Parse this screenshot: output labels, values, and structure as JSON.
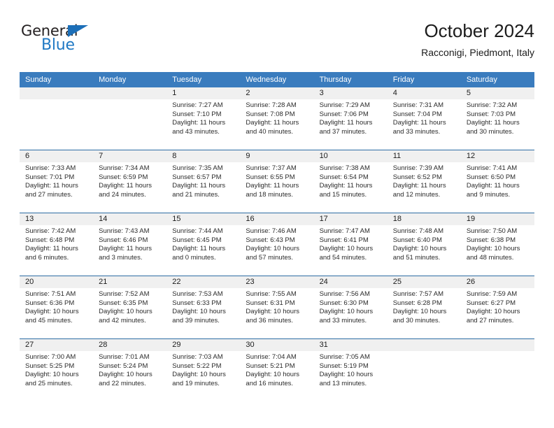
{
  "brand": {
    "name_top": "General",
    "name_bottom": "Blue",
    "triangle_icon": "play-triangle-icon",
    "color_dark": "#231f20",
    "color_blue": "#2079c4"
  },
  "header": {
    "title": "October 2024",
    "subtitle": "Racconigi, Piedmont, Italy"
  },
  "theme": {
    "header_blue": "#3a7cbe",
    "row_divider_blue": "#2e6da4",
    "day_number_band": "#f0f0f0"
  },
  "weekdays": [
    "Sunday",
    "Monday",
    "Tuesday",
    "Wednesday",
    "Thursday",
    "Friday",
    "Saturday"
  ],
  "weeks": [
    [
      {
        "day": "",
        "sunrise": "",
        "sunset": "",
        "daylight": ""
      },
      {
        "day": "",
        "sunrise": "",
        "sunset": "",
        "daylight": ""
      },
      {
        "day": "1",
        "sunrise": "Sunrise: 7:27 AM",
        "sunset": "Sunset: 7:10 PM",
        "daylight": "Daylight: 11 hours and 43 minutes."
      },
      {
        "day": "2",
        "sunrise": "Sunrise: 7:28 AM",
        "sunset": "Sunset: 7:08 PM",
        "daylight": "Daylight: 11 hours and 40 minutes."
      },
      {
        "day": "3",
        "sunrise": "Sunrise: 7:29 AM",
        "sunset": "Sunset: 7:06 PM",
        "daylight": "Daylight: 11 hours and 37 minutes."
      },
      {
        "day": "4",
        "sunrise": "Sunrise: 7:31 AM",
        "sunset": "Sunset: 7:04 PM",
        "daylight": "Daylight: 11 hours and 33 minutes."
      },
      {
        "day": "5",
        "sunrise": "Sunrise: 7:32 AM",
        "sunset": "Sunset: 7:03 PM",
        "daylight": "Daylight: 11 hours and 30 minutes."
      }
    ],
    [
      {
        "day": "6",
        "sunrise": "Sunrise: 7:33 AM",
        "sunset": "Sunset: 7:01 PM",
        "daylight": "Daylight: 11 hours and 27 minutes."
      },
      {
        "day": "7",
        "sunrise": "Sunrise: 7:34 AM",
        "sunset": "Sunset: 6:59 PM",
        "daylight": "Daylight: 11 hours and 24 minutes."
      },
      {
        "day": "8",
        "sunrise": "Sunrise: 7:35 AM",
        "sunset": "Sunset: 6:57 PM",
        "daylight": "Daylight: 11 hours and 21 minutes."
      },
      {
        "day": "9",
        "sunrise": "Sunrise: 7:37 AM",
        "sunset": "Sunset: 6:55 PM",
        "daylight": "Daylight: 11 hours and 18 minutes."
      },
      {
        "day": "10",
        "sunrise": "Sunrise: 7:38 AM",
        "sunset": "Sunset: 6:54 PM",
        "daylight": "Daylight: 11 hours and 15 minutes."
      },
      {
        "day": "11",
        "sunrise": "Sunrise: 7:39 AM",
        "sunset": "Sunset: 6:52 PM",
        "daylight": "Daylight: 11 hours and 12 minutes."
      },
      {
        "day": "12",
        "sunrise": "Sunrise: 7:41 AM",
        "sunset": "Sunset: 6:50 PM",
        "daylight": "Daylight: 11 hours and 9 minutes."
      }
    ],
    [
      {
        "day": "13",
        "sunrise": "Sunrise: 7:42 AM",
        "sunset": "Sunset: 6:48 PM",
        "daylight": "Daylight: 11 hours and 6 minutes."
      },
      {
        "day": "14",
        "sunrise": "Sunrise: 7:43 AM",
        "sunset": "Sunset: 6:46 PM",
        "daylight": "Daylight: 11 hours and 3 minutes."
      },
      {
        "day": "15",
        "sunrise": "Sunrise: 7:44 AM",
        "sunset": "Sunset: 6:45 PM",
        "daylight": "Daylight: 11 hours and 0 minutes."
      },
      {
        "day": "16",
        "sunrise": "Sunrise: 7:46 AM",
        "sunset": "Sunset: 6:43 PM",
        "daylight": "Daylight: 10 hours and 57 minutes."
      },
      {
        "day": "17",
        "sunrise": "Sunrise: 7:47 AM",
        "sunset": "Sunset: 6:41 PM",
        "daylight": "Daylight: 10 hours and 54 minutes."
      },
      {
        "day": "18",
        "sunrise": "Sunrise: 7:48 AM",
        "sunset": "Sunset: 6:40 PM",
        "daylight": "Daylight: 10 hours and 51 minutes."
      },
      {
        "day": "19",
        "sunrise": "Sunrise: 7:50 AM",
        "sunset": "Sunset: 6:38 PM",
        "daylight": "Daylight: 10 hours and 48 minutes."
      }
    ],
    [
      {
        "day": "20",
        "sunrise": "Sunrise: 7:51 AM",
        "sunset": "Sunset: 6:36 PM",
        "daylight": "Daylight: 10 hours and 45 minutes."
      },
      {
        "day": "21",
        "sunrise": "Sunrise: 7:52 AM",
        "sunset": "Sunset: 6:35 PM",
        "daylight": "Daylight: 10 hours and 42 minutes."
      },
      {
        "day": "22",
        "sunrise": "Sunrise: 7:53 AM",
        "sunset": "Sunset: 6:33 PM",
        "daylight": "Daylight: 10 hours and 39 minutes."
      },
      {
        "day": "23",
        "sunrise": "Sunrise: 7:55 AM",
        "sunset": "Sunset: 6:31 PM",
        "daylight": "Daylight: 10 hours and 36 minutes."
      },
      {
        "day": "24",
        "sunrise": "Sunrise: 7:56 AM",
        "sunset": "Sunset: 6:30 PM",
        "daylight": "Daylight: 10 hours and 33 minutes."
      },
      {
        "day": "25",
        "sunrise": "Sunrise: 7:57 AM",
        "sunset": "Sunset: 6:28 PM",
        "daylight": "Daylight: 10 hours and 30 minutes."
      },
      {
        "day": "26",
        "sunrise": "Sunrise: 7:59 AM",
        "sunset": "Sunset: 6:27 PM",
        "daylight": "Daylight: 10 hours and 27 minutes."
      }
    ],
    [
      {
        "day": "27",
        "sunrise": "Sunrise: 7:00 AM",
        "sunset": "Sunset: 5:25 PM",
        "daylight": "Daylight: 10 hours and 25 minutes."
      },
      {
        "day": "28",
        "sunrise": "Sunrise: 7:01 AM",
        "sunset": "Sunset: 5:24 PM",
        "daylight": "Daylight: 10 hours and 22 minutes."
      },
      {
        "day": "29",
        "sunrise": "Sunrise: 7:03 AM",
        "sunset": "Sunset: 5:22 PM",
        "daylight": "Daylight: 10 hours and 19 minutes."
      },
      {
        "day": "30",
        "sunrise": "Sunrise: 7:04 AM",
        "sunset": "Sunset: 5:21 PM",
        "daylight": "Daylight: 10 hours and 16 minutes."
      },
      {
        "day": "31",
        "sunrise": "Sunrise: 7:05 AM",
        "sunset": "Sunset: 5:19 PM",
        "daylight": "Daylight: 10 hours and 13 minutes."
      },
      {
        "day": "",
        "sunrise": "",
        "sunset": "",
        "daylight": ""
      },
      {
        "day": "",
        "sunrise": "",
        "sunset": "",
        "daylight": ""
      }
    ]
  ]
}
